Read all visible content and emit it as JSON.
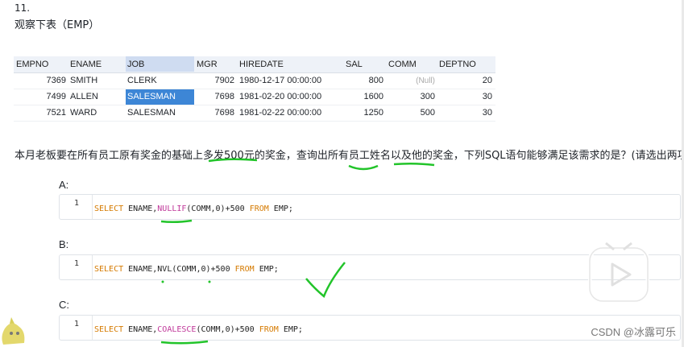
{
  "question_number": "11.",
  "question_title": "观察下表（EMP）",
  "table": {
    "headers": [
      "EMPNO",
      "ENAME",
      "JOB",
      "MGR",
      "HIREDATE",
      "SAL",
      "COMM",
      "DEPTNO"
    ],
    "rows": [
      [
        "7369",
        "SMITH",
        "CLERK",
        "7902",
        "1980-12-17 00:00:00",
        "800",
        "(Null)",
        "20"
      ],
      [
        "7499",
        "ALLEN",
        "SALESMAN",
        "7698",
        "1981-02-20 00:00:00",
        "1600",
        "300",
        "30"
      ],
      [
        "7521",
        "WARD",
        "SALESMAN",
        "7698",
        "1981-02-22 00:00:00",
        "1250",
        "500",
        "30"
      ]
    ]
  },
  "question_text": "本月老板要在所有员工原有奖金的基础上多发500元的奖金，查询出所有员工姓名以及他的奖金，下列SQL语句能够满足该需求的是？(请选出两项)",
  "options": [
    {
      "label": "A:",
      "line": "1",
      "kw1": "SELECT",
      "col": " ENAME,",
      "fn": "NULLIF",
      "args": "(COMM,0)+500 ",
      "kw2": "FROM",
      "tail": " EMP;"
    },
    {
      "label": "B:",
      "line": "1",
      "kw1": "SELECT",
      "col": " ENAME,",
      "fn": "NVL",
      "args": "(COMM,0)+500 ",
      "kw2": "FROM",
      "tail": " EMP;"
    },
    {
      "label": "C:",
      "line": "1",
      "kw1": "SELECT",
      "col": " ENAME,",
      "fn": "COALESCE",
      "args": "(COMM,0)+500 ",
      "kw2": "FROM",
      "tail": " EMP;"
    }
  ],
  "watermark": "CSDN @冰露可乐",
  "colors": {
    "accent": "#3d86d6",
    "keyword": "#d57a00",
    "function": "#c0389a",
    "annotation": "#22c42a"
  },
  "icons": {
    "play": "play-icon",
    "mascot": "mascot-icon"
  }
}
